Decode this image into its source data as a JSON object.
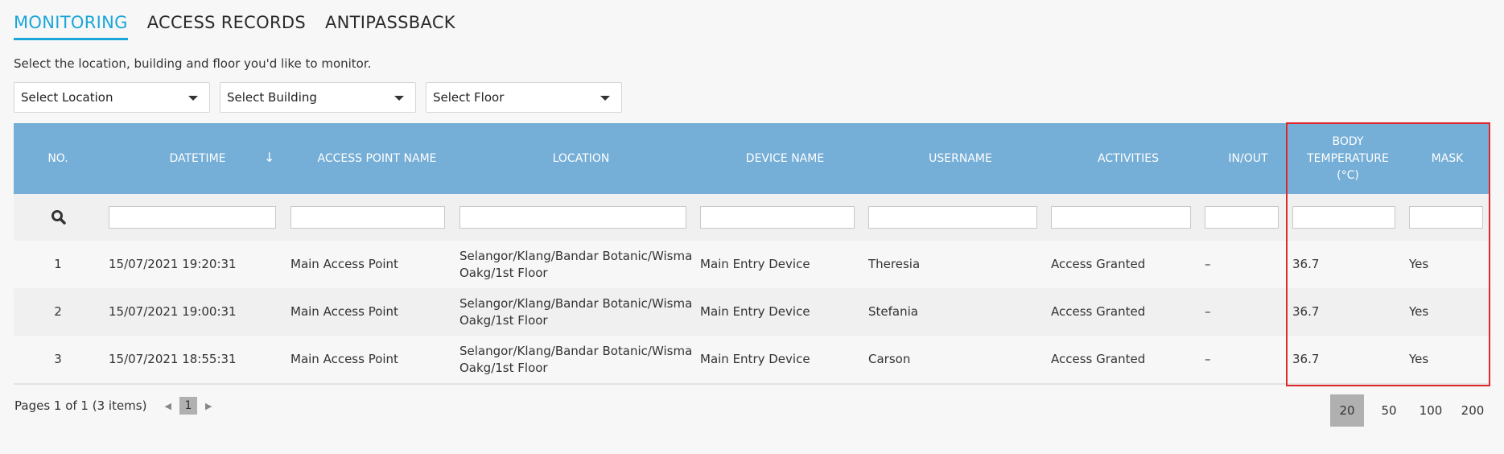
{
  "tabs": [
    {
      "label": "MONITORING",
      "active": true
    },
    {
      "label": "ACCESS RECORDS",
      "active": false
    },
    {
      "label": "ANTIPASSBACK",
      "active": false
    }
  ],
  "instructions": "Select the location, building and floor you'd like to monitor.",
  "selects": {
    "location": {
      "placeholder": "Select Location"
    },
    "building": {
      "placeholder": "Select Building"
    },
    "floor": {
      "placeholder": "Select Floor"
    }
  },
  "columns": {
    "no": "NO.",
    "datetime": "DATETIME",
    "access_point_name": "ACCESS POINT NAME",
    "location": "LOCATION",
    "device_name": "DEVICE NAME",
    "username": "USERNAME",
    "activities": "ACTIVITIES",
    "in_out": "IN/OUT",
    "body_temperature_line1": "BODY",
    "body_temperature_line2": "TEMPERATURE",
    "body_temperature_line3": "(°C)",
    "mask": "MASK"
  },
  "sort": {
    "column": "datetime",
    "direction": "descending",
    "icon": "arrow-down-icon"
  },
  "rows": [
    {
      "no": "1",
      "datetime": "15/07/2021 19:20:31",
      "access_point_name": "Main Access Point",
      "location_line1": "Selangor/Klang/Bandar Botanic/Wisma",
      "location_line2": "Oakg/1st Floor",
      "device_name": "Main Entry Device",
      "username": "Theresia",
      "activities": "Access Granted",
      "in_out": "–",
      "body_temperature": "36.7",
      "mask": "Yes"
    },
    {
      "no": "2",
      "datetime": "15/07/2021 19:00:31",
      "access_point_name": "Main Access Point",
      "location_line1": "Selangor/Klang/Bandar Botanic/Wisma",
      "location_line2": "Oakg/1st Floor",
      "device_name": "Main Entry Device",
      "username": "Stefania",
      "activities": "Access Granted",
      "in_out": "–",
      "body_temperature": "36.7",
      "mask": "Yes"
    },
    {
      "no": "3",
      "datetime": "15/07/2021 18:55:31",
      "access_point_name": "Main Access Point",
      "location_line1": "Selangor/Klang/Bandar Botanic/Wisma",
      "location_line2": "Oakg/1st Floor",
      "device_name": "Main Entry Device",
      "username": "Carson",
      "activities": "Access Granted",
      "in_out": "–",
      "body_temperature": "36.7",
      "mask": "Yes"
    }
  ],
  "pager": {
    "summary": "Pages 1 of 1 (3 items)",
    "current_page": "1"
  },
  "page_sizes": [
    {
      "label": "20",
      "active": true
    },
    {
      "label": "50",
      "active": false
    },
    {
      "label": "100",
      "active": false
    },
    {
      "label": "200",
      "active": false
    }
  ],
  "colors": {
    "accent": "#1ba6d8",
    "header": "#75aed6",
    "highlight": "#e0272c"
  }
}
